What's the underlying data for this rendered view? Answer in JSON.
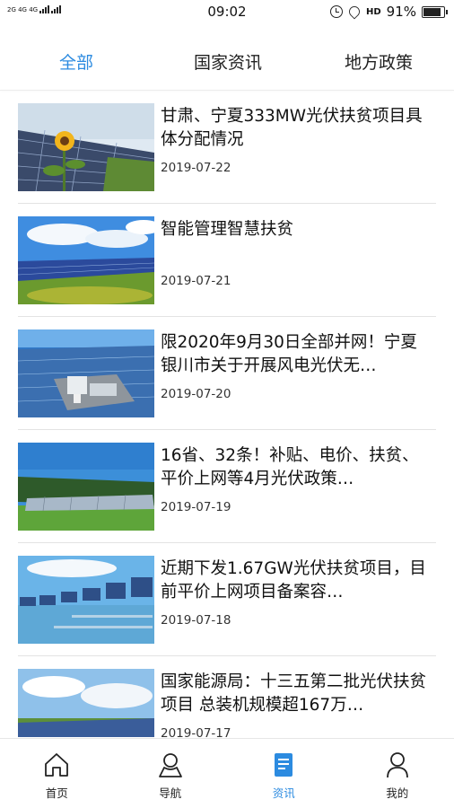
{
  "status_bar": {
    "network_label": "2G 4G 4G",
    "time": "09:02",
    "hd_label": "HD",
    "battery": "91%",
    "battery_level": 0.91
  },
  "tabs": [
    {
      "label": "全部",
      "active": true
    },
    {
      "label": "国家资讯",
      "active": false
    },
    {
      "label": "地方政策",
      "active": false
    }
  ],
  "news": [
    {
      "title": "甘肃、宁夏333MW光伏扶贫项目具体分配情况",
      "date": "2019-07-22",
      "image": "sunflower-solar-image"
    },
    {
      "title": "智能管理智慧扶贫",
      "date": "2019-07-21",
      "image": "solar-field-image"
    },
    {
      "title": "限2020年9月30日全部并网！宁夏银川市关于开展风电光伏无…",
      "date": "2019-07-20",
      "image": "solar-station-image"
    },
    {
      "title": "16省、32条！补贴、电价、扶贫、平价上网等4月光伏政策…",
      "date": "2019-07-19",
      "image": "solar-forest-image"
    },
    {
      "title": "近期下发1.67GW光伏扶贫项目，目前平价上网项目备案容…",
      "date": "2019-07-18",
      "image": "floating-solar-image"
    },
    {
      "title": " 国家能源局：十三五第二批光伏扶贫项目 总装机规模超167万…",
      "date": "2019-07-17",
      "image": "solar-sky-image"
    }
  ],
  "bottom_nav": [
    {
      "label": "首页",
      "icon": "home-icon",
      "active": false
    },
    {
      "label": "导航",
      "icon": "user-nav-icon",
      "active": false
    },
    {
      "label": "资讯",
      "icon": "news-doc-icon",
      "active": true
    },
    {
      "label": "我的",
      "icon": "person-icon",
      "active": false
    }
  ],
  "colors": {
    "accent": "#2c8be0",
    "text": "#111111",
    "divider": "#e3e3e3"
  }
}
